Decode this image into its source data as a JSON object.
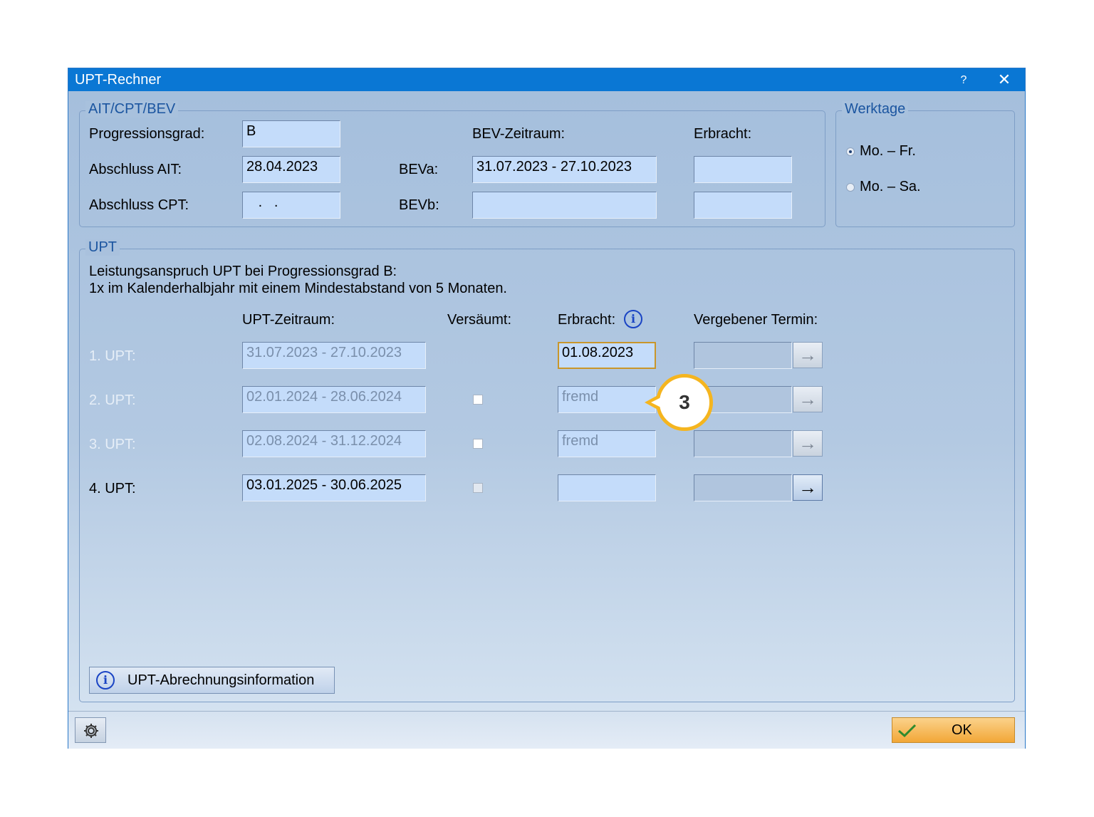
{
  "window": {
    "title": "UPT-Rechner",
    "help_label": "?",
    "close_label": "✕"
  },
  "ait_group": {
    "legend": "AIT/CPT/BEV",
    "progressionsgrad_label": "Progressionsgrad:",
    "progressionsgrad_value": "B",
    "abschluss_ait_label": "Abschluss AIT:",
    "abschluss_ait_value": "28.04.2023",
    "abschluss_cpt_label": "Abschluss CPT:",
    "abschluss_cpt_value": "   .   .",
    "bev_zeitraum_label": "BEV-Zeitraum:",
    "erbracht_label": "Erbracht:",
    "beva_label": "BEVa:",
    "beva_value": "31.07.2023 - 27.10.2023",
    "bevb_label": "BEVb:",
    "bevb_value": "",
    "beva_erbracht_value": "",
    "bevb_erbracht_value": ""
  },
  "werktage_group": {
    "legend": "Werktage",
    "options": [
      {
        "label": "Mo. – Fr.",
        "checked": true
      },
      {
        "label": "Mo. – Sa.",
        "checked": false
      }
    ]
  },
  "upt_group": {
    "legend": "UPT",
    "description_line1": "Leistungsanspruch UPT bei Progressionsgrad B:",
    "description_line2": "1x im Kalenderhalbjahr mit einem Mindestabstand von 5 Monaten.",
    "headers": {
      "zeitraum": "UPT-Zeitraum:",
      "versaeumt": "Versäumt:",
      "erbracht": "Erbracht:",
      "termin": "Vergebener Termin:"
    },
    "rows": [
      {
        "label": "1. UPT:",
        "zeitraum": "31.07.2023 - 27.10.2023",
        "erbracht": "01.08.2023",
        "termin": ""
      },
      {
        "label": "2. UPT:",
        "zeitraum": "02.01.2024 - 28.06.2024",
        "erbracht": "fremd",
        "termin": ""
      },
      {
        "label": "3. UPT:",
        "zeitraum": "02.08.2024 - 31.12.2024",
        "erbracht": "fremd",
        "termin": ""
      },
      {
        "label": "4. UPT:",
        "zeitraum": "03.01.2025 - 30.06.2025",
        "erbracht": "",
        "termin": ""
      }
    ],
    "info_button_label": "UPT-Abrechnungsinformation"
  },
  "footer": {
    "ok_label": "OK"
  },
  "callout": {
    "number": "3",
    "color": "#f5b51f"
  },
  "colors": {
    "titlebar": "#0a77d4",
    "field": "#c4dcfa",
    "ok_button": "#f2a737"
  },
  "icons": [
    "help-icon",
    "close-icon",
    "info-icon",
    "arrow-right-icon",
    "gear-icon",
    "checkmark-icon"
  ]
}
